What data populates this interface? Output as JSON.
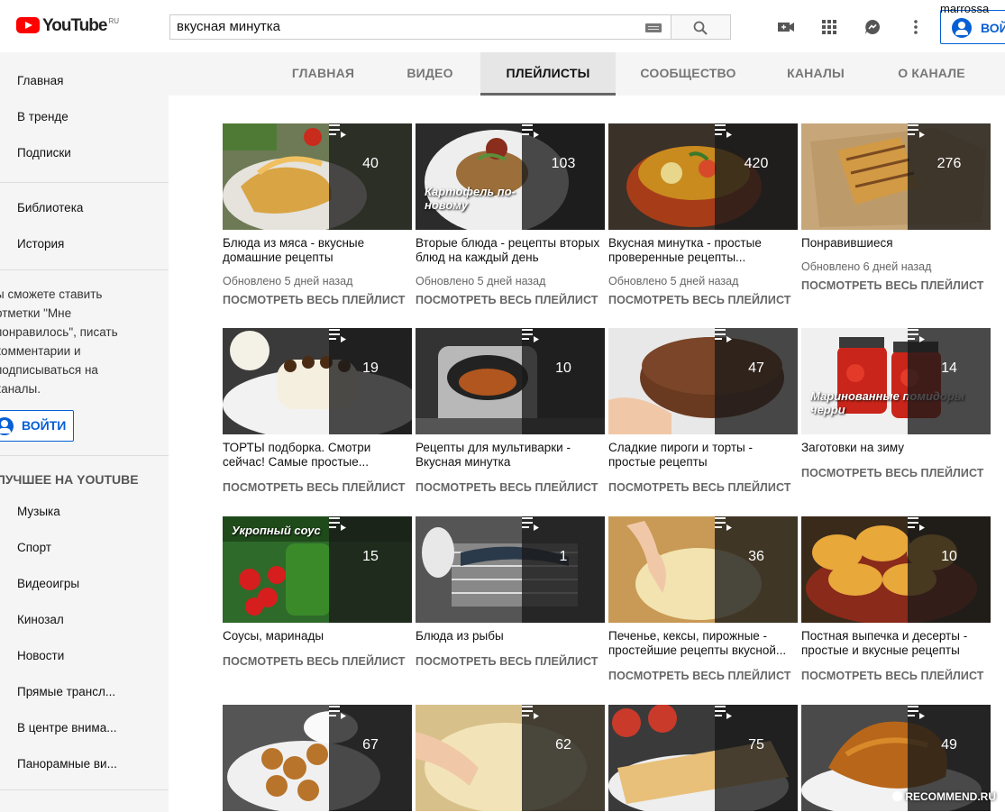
{
  "header": {
    "logo_text": "YouTube",
    "logo_region": "RU",
    "search_value": "вкусная минутка",
    "username": "marrossa",
    "signin_label": "ВОЙТИ"
  },
  "sidebar": {
    "items_top": [
      "Главная",
      "В тренде",
      "Подписки"
    ],
    "items_library": [
      "Библиотека",
      "История"
    ],
    "note": "ы сможете ставить\nотметки \"Мне\nпонравилось\", писать\nкомментарии и\nподписываться на\nканалы.",
    "signin_label": "ВОЙТИ",
    "best_heading": "ЛУЧШЕЕ НА YOUTUBE",
    "best_items": [
      "Музыка",
      "Спорт",
      "Видеоигры",
      "Кинозал",
      "Новости",
      "Прямые трансл...",
      "В центре внима...",
      "Панорамные ви..."
    ]
  },
  "tabs": [
    "ГЛАВНАЯ",
    "ВИДЕО",
    "ПЛЕЙЛИСТЫ",
    "СООБЩЕСТВО",
    "КАНАЛЫ",
    "О КАНАЛЕ"
  ],
  "active_tab": "ПЛЕЙЛИСТЫ",
  "view_all_label": "ПОСМОТРЕТЬ ВЕСЬ ПЛЕЙЛИСТ",
  "playlists": [
    {
      "title": "Блюда из мяса - вкусные домашние рецепты",
      "count": "40",
      "updated": "Обновлено 5 дней назад",
      "thumb_text": ""
    },
    {
      "title": "Вторые блюда - рецепты вторых блюд на каждый день",
      "count": "103",
      "updated": "Обновлено 5 дней назад",
      "thumb_text": "Картофель по-новому"
    },
    {
      "title": "Вкусная минутка - простые проверенные рецепты...",
      "count": "420",
      "updated": "Обновлено 5 дней назад",
      "thumb_text": ""
    },
    {
      "title": "Понравившиеся",
      "count": "276",
      "updated": "Обновлено 6 дней назад",
      "thumb_text": ""
    },
    {
      "title": "ТОРТЫ подборка. Смотри сейчас! Самые простые...",
      "count": "19",
      "updated": "",
      "thumb_text": ""
    },
    {
      "title": "Рецепты для мультиварки - Вкусная минутка",
      "count": "10",
      "updated": "",
      "thumb_text": ""
    },
    {
      "title": "Сладкие пироги и торты - простые рецепты",
      "count": "47",
      "updated": "",
      "thumb_text": ""
    },
    {
      "title": "Заготовки на зиму",
      "count": "14",
      "updated": "",
      "thumb_text": "Маринованные помидоры черри"
    },
    {
      "title": "Соусы, маринады",
      "count": "15",
      "updated": "",
      "thumb_text": "Укропный соус"
    },
    {
      "title": "Блюда из рыбы",
      "count": "1",
      "updated": "",
      "thumb_text": ""
    },
    {
      "title": "Печенье, кексы, пирожные - простейшие рецепты вкусной...",
      "count": "36",
      "updated": "",
      "thumb_text": ""
    },
    {
      "title": "Постная выпечка и десерты - простые и вкусные рецепты",
      "count": "10",
      "updated": "",
      "thumb_text": ""
    },
    {
      "title": "",
      "count": "67",
      "updated": "",
      "thumb_text": ""
    },
    {
      "title": "",
      "count": "62",
      "updated": "",
      "thumb_text": ""
    },
    {
      "title": "",
      "count": "75",
      "updated": "",
      "thumb_text": ""
    },
    {
      "title": "",
      "count": "49",
      "updated": "",
      "thumb_text": ""
    }
  ],
  "watermark": "RECOMMEND.RU",
  "colors": {
    "brand_red": "#ff0000",
    "accent_blue": "#065fd4",
    "sidebar_bg": "#f5f5f5"
  }
}
